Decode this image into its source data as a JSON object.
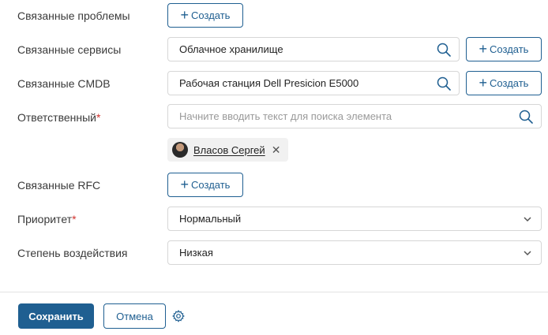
{
  "form": {
    "related_problems": {
      "label": "Связанные проблемы",
      "create_label": "Создать"
    },
    "related_services": {
      "label": "Связанные сервисы",
      "value": "Облачное хранилище",
      "create_label": "Создать"
    },
    "related_cmdb": {
      "label": "Связанные CMDB",
      "value": "Рабочая станция Dell Presicion E5000",
      "create_label": "Создать"
    },
    "responsible": {
      "label": "Ответственный",
      "required_mark": "*",
      "placeholder": "Начните вводить текст для поиска элемента",
      "selected": {
        "name": "Власов Сергей"
      }
    },
    "related_rfc": {
      "label": "Связанные RFC",
      "create_label": "Создать"
    },
    "priority": {
      "label": "Приоритет",
      "required_mark": "*",
      "value": "Нормальный"
    },
    "impact": {
      "label": "Степень воздействия",
      "value": "Низкая"
    }
  },
  "footer": {
    "save_label": "Сохранить",
    "cancel_label": "Отмена"
  },
  "icons": {
    "plus": "plus-icon",
    "search": "search-icon",
    "chevron": "chevron-down-icon",
    "close": "close-icon",
    "gear": "gear-icon"
  },
  "colors": {
    "accent": "#1f5f91",
    "required": "#d0312d",
    "border": "#d6d6d6"
  }
}
